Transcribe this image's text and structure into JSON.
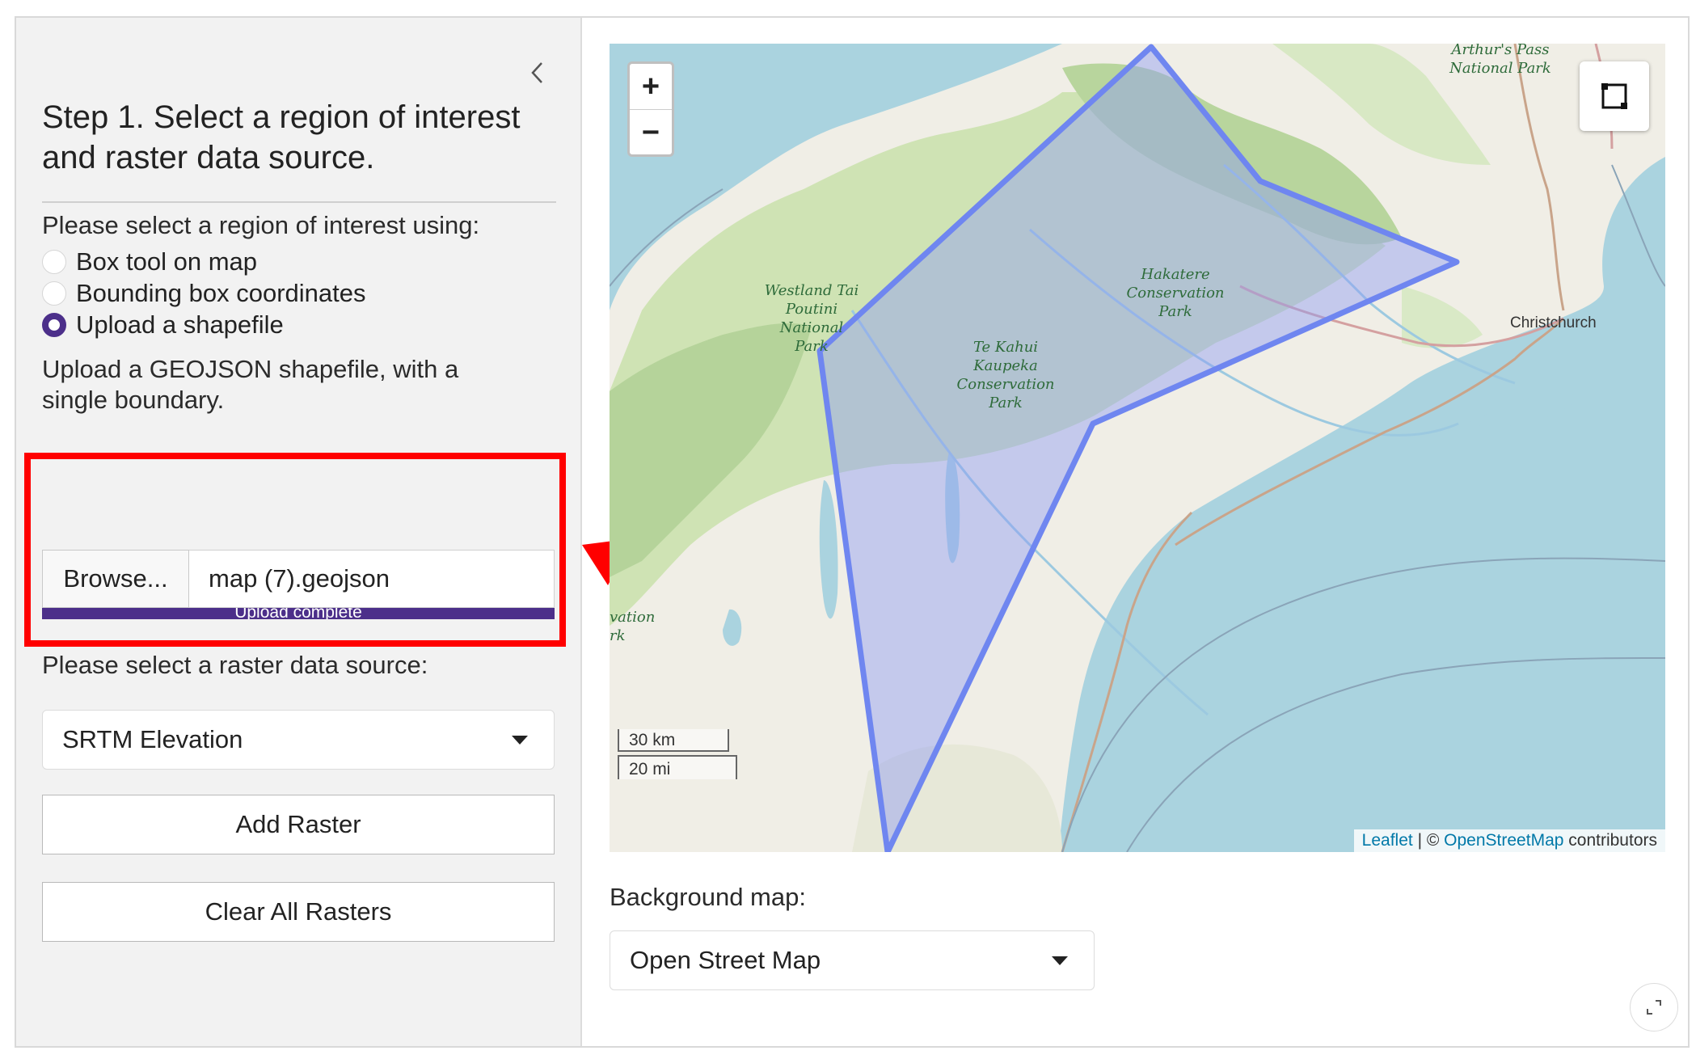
{
  "sidebar": {
    "step_title": "Step 1. Select a region of interest and raster data source.",
    "region_label": "Please select a region of interest using:",
    "region_options": [
      {
        "label": "Box tool on map",
        "checked": false
      },
      {
        "label": "Bounding box coordinates",
        "checked": false
      },
      {
        "label": "Upload a shapefile",
        "checked": true
      }
    ],
    "upload_label": "Upload a GEOJSON shapefile, with a single boundary.",
    "browse_label": "Browse...",
    "file_name": "map (7).geojson",
    "upload_status": "Upload complete",
    "upload_progress_percent": 100,
    "raster_label": "Please select a raster data source:",
    "raster_selected": "SRTM Elevation",
    "add_raster_label": "Add Raster",
    "clear_rasters_label": "Clear All Rasters"
  },
  "map": {
    "zoom_in": "+",
    "zoom_out": "−",
    "scale_km": "30 km",
    "scale_mi": "20 mi",
    "attribution": {
      "leaflet": "Leaflet",
      "separator": " | © ",
      "osm": "OpenStreetMap",
      "suffix": " contributors"
    },
    "labels": {
      "arthurs_pass": "Arthur's Pass National Park",
      "westland": "Westland Tai Poutini National Park",
      "hakatere": "Hakatere Conservation Park",
      "te_kahui": "Te Kahui Kaupeka Conservation Park",
      "christchurch": "Christchurch",
      "edge": "vation rk"
    }
  },
  "background_map": {
    "label": "Background map:",
    "selected": "Open Street Map"
  },
  "colors": {
    "accent": "#4c2f8a",
    "highlight": "#ff0000",
    "polygon_stroke": "#6f86f0",
    "polygon_fill": "#8f9cf5",
    "water": "#aad3df"
  }
}
